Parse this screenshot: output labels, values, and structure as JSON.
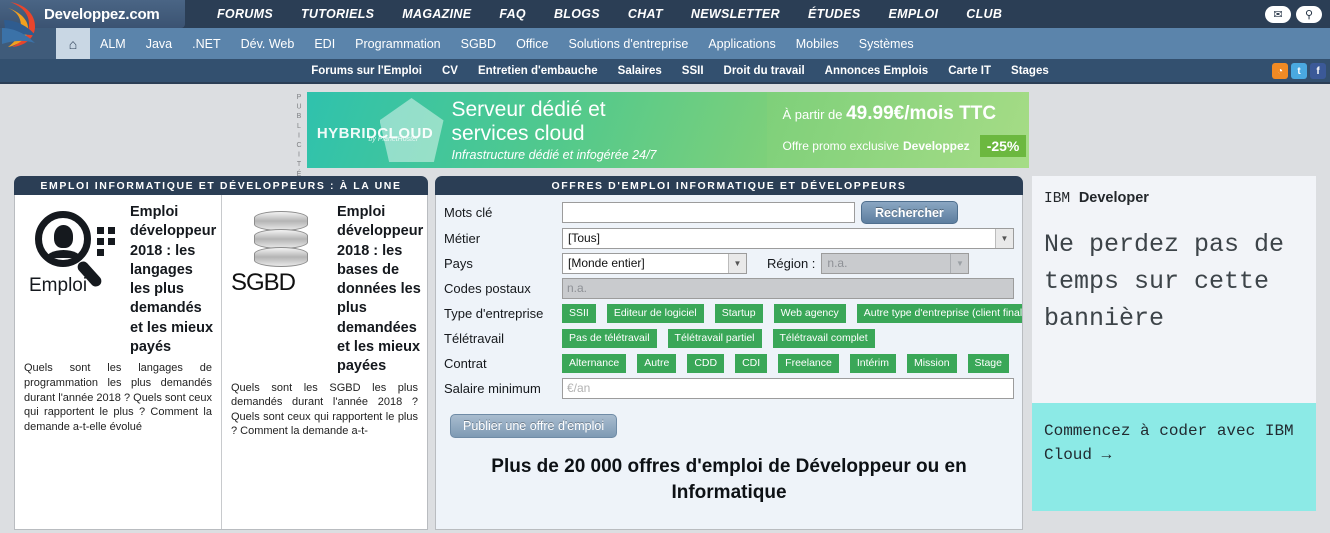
{
  "site": {
    "logo_text": "Developpez.com",
    "main_menu": [
      "FORUMS",
      "TUTORIELS",
      "MAGAZINE",
      "FAQ",
      "BLOGS",
      "CHAT",
      "NEWSLETTER",
      "ÉTUDES",
      "EMPLOI",
      "CLUB"
    ],
    "top_icons": [
      {
        "name": "mail-icon",
        "glyph": "✉"
      },
      {
        "name": "search-icon",
        "glyph": "⚲"
      }
    ],
    "nav2": [
      "ALM",
      "Java",
      ".NET",
      "Dév. Web",
      "EDI",
      "Programmation",
      "SGBD",
      "Office",
      "Solutions d'entreprise",
      "Applications",
      "Mobiles",
      "Systèmes"
    ],
    "home_glyph": "⌂",
    "nav3": [
      "Forums sur l'Emploi",
      "CV",
      "Entretien d'embauche",
      "Salaires",
      "SSII",
      "Droit du travail",
      "Annonces Emplois",
      "Carte IT",
      "Stages"
    ],
    "social": [
      {
        "name": "rss-icon",
        "glyph": "◔",
        "color": "#f08a24"
      },
      {
        "name": "twitter-icon",
        "glyph": "t",
        "color": "#4aa9e0"
      },
      {
        "name": "facebook-icon",
        "glyph": "f",
        "color": "#3b5998"
      }
    ]
  },
  "ad": {
    "publicite_label": "PUBLICITÉ",
    "brand": "HYBRIDCLOUD",
    "brand_sub": "by PlanetHoster",
    "line1": "Serveur dédié et",
    "line2": "services cloud",
    "line3": "Infrastructure dédié et infogérée 24/7",
    "price_prefix": "À partir de",
    "price": "49.99€/mois TTC",
    "promo_prefix": "Offre promo exclusive",
    "promo_brand": "Developpez",
    "badge": "-25%"
  },
  "left_panel": {
    "header": "EMPLOI INFORMATIQUE ET DÉVELOPPEURS : À LA UNE",
    "cards": [
      {
        "icon_word": "Emploi",
        "title": "Emploi développeur 2018 : les langages les plus demandés et les mieux payés",
        "body": "Quels sont les langages de programmation les plus demandés durant l'année 2018 ? Quels sont ceux qui rapportent le plus ? Comment la demande a-t-elle évolué"
      },
      {
        "icon_word": "SGBD",
        "title": "Emploi développeur 2018 : les bases de données les plus demandées et les mieux payées",
        "body": "Quels sont les SGBD les plus demandés durant l'année 2018 ? Quels sont ceux qui rapportent le plus ? Comment la demande a-t-"
      }
    ]
  },
  "search_panel": {
    "header": "OFFRES D'EMPLOI INFORMATIQUE ET DÉVELOPPEURS",
    "labels": {
      "keywords": "Mots clé",
      "metier": "Métier",
      "pays": "Pays",
      "region": "Région :",
      "postal": "Codes postaux",
      "company_type": "Type d'entreprise",
      "telework": "Télétravail",
      "contract": "Contrat",
      "salary": "Salaire minimum"
    },
    "values": {
      "keywords": "",
      "metier": "[Tous]",
      "pays": "[Monde entier]",
      "region": "n.a.",
      "postal": "n.a.",
      "salary_placeholder": "€/an"
    },
    "search_button": "Rechercher",
    "publish_button": "Publier une offre d'emploi",
    "company_types": [
      "SSII",
      "Editeur de logiciel",
      "Startup",
      "Web agency",
      "Autre type d'entreprise (client final)"
    ],
    "telework_options": [
      "Pas de télétravail",
      "Télétravail partiel",
      "Télétravail complet"
    ],
    "contract_options": [
      "Alternance",
      "Autre",
      "CDD",
      "CDI",
      "Freelance",
      "Intérim",
      "Mission",
      "Stage"
    ],
    "headline": "Plus de 20 000 offres d'emploi de Développeur ou en Informatique",
    "tag_color": "#3aa758"
  },
  "right_ad": {
    "brand_light": "IBM ",
    "brand_bold": "Developer",
    "headline": "Ne perdez pas de temps sur cette bannière",
    "cta": "Commencez à coder avec IBM Cloud  →",
    "cta_bg": "#8ceae6"
  }
}
